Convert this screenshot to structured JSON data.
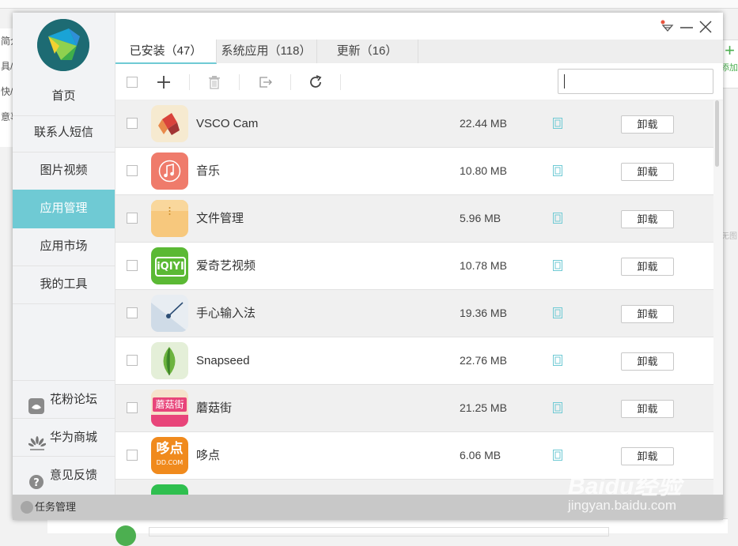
{
  "background": {
    "left_items": [
      "简介",
      "具/原",
      "快/抄",
      "意事"
    ],
    "right_button_label": "添加",
    "right_text": "无图"
  },
  "sidebar": {
    "items": [
      {
        "label": "首页",
        "active": false
      },
      {
        "label": "联系人短信",
        "active": false
      },
      {
        "label": "图片视频",
        "active": false
      },
      {
        "label": "应用管理",
        "active": true
      },
      {
        "label": "应用市场",
        "active": false
      },
      {
        "label": "我的工具",
        "active": false
      }
    ],
    "links": [
      {
        "label": "花粉论坛",
        "icon": "huafen-forum-icon"
      },
      {
        "label": "华为商城",
        "icon": "huawei-logo-icon"
      },
      {
        "label": "意见反馈",
        "icon": "help-question-icon"
      }
    ]
  },
  "statusbar": {
    "label": "任务管理"
  },
  "tabs": [
    {
      "label": "已安装（47）",
      "active": true
    },
    {
      "label": "系统应用（118）",
      "active": false
    },
    {
      "label": "更新（16）",
      "active": false
    }
  ],
  "search": {
    "value": "",
    "placeholder": ""
  },
  "apps": [
    {
      "name": "VSCO Cam",
      "size": "22.44 MB",
      "action": "卸载"
    },
    {
      "name": "音乐",
      "size": "10.80 MB",
      "action": "卸载"
    },
    {
      "name": "文件管理",
      "size": "5.96 MB",
      "action": "卸载"
    },
    {
      "name": "爱奇艺视频",
      "size": "10.78 MB",
      "action": "卸载"
    },
    {
      "name": "手心输入法",
      "size": "19.36 MB",
      "action": "卸载"
    },
    {
      "name": "Snapseed",
      "size": "22.76 MB",
      "action": "卸载"
    },
    {
      "name": "蘑菇街",
      "size": "21.25 MB",
      "action": "卸载"
    },
    {
      "name": "哆点",
      "size": "6.06 MB",
      "action": "卸载"
    }
  ],
  "icon_text": {
    "mogujie": "蘑菇街",
    "duodian_top": "哆点",
    "duodian_bottom": "DD.COM",
    "iqiyi": "iQIYI"
  },
  "watermark": {
    "brand": "Baidu经验",
    "url": "jingyan.baidu.com"
  },
  "colors": {
    "accent": "#6fcad4",
    "statusbar": "#c8c8c8",
    "sd_icon": "#6fcad4"
  }
}
